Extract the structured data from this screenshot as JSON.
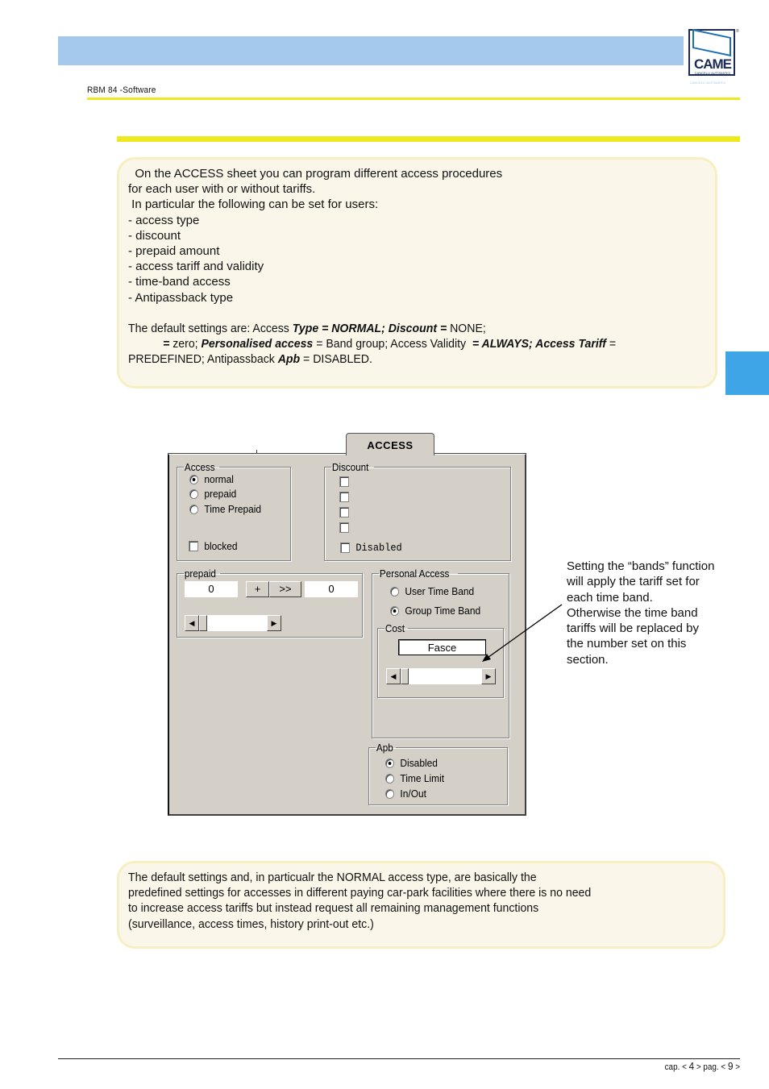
{
  "header": {
    "doc_title": "RBM 84 -Software",
    "logo": {
      "name": "CAME",
      "subtitle": "CANCELLI AUTOMATICI",
      "registered": "®"
    },
    "colors": {
      "band": "#a4c9ec",
      "rule": "#eee81e",
      "side_tab": "#3ea6e6"
    }
  },
  "intro_note": {
    "lines": [
      "  On the ACCESS sheet you can program different access procedures",
      "for each user with or without tariffs.",
      " In particular the following can be set for users:",
      "- access type",
      "- discount",
      "- prepaid amount",
      "- access tariff and validity",
      "- time-band access",
      "- Antipassback type"
    ],
    "defaults": {
      "l1_a": "The default settings are: Access ",
      "l1_b": "Type = NORMAL; Discount = ",
      "l1_c": "NONE;",
      "l2_a": "           ",
      "l2_b": "= ",
      "l2_c": "zero; ",
      "l2_d": "Personalised access",
      "l2_e": " = Band group; Access Validity  ",
      "l2_f": "= ALWAYS; Access Tariff",
      "l2_g": " =",
      "l3_a": "PREDEFINED; Antipassback ",
      "l3_b": "Apb",
      "l3_c": " = DISABLED."
    }
  },
  "dialog": {
    "active_tab": "ACCESS",
    "access_group": {
      "legend": "Access",
      "options": [
        {
          "label": "normal",
          "selected": true
        },
        {
          "label": "prepaid",
          "selected": false
        },
        {
          "label": "Time Prepaid",
          "selected": false
        }
      ],
      "blocked": {
        "label": "blocked",
        "checked": false
      }
    },
    "discount_group": {
      "legend": "Discount",
      "checkboxes": [
        false,
        false,
        false,
        false
      ],
      "disabled": {
        "label": "Disabled",
        "checked": false
      }
    },
    "prepaid_group": {
      "legend": "prepaid",
      "left_value": "0",
      "plus_label": "+",
      "transfer_label": ">>",
      "right_value": "0",
      "scroll_left": "◀",
      "scroll_right": "▶"
    },
    "personal_access_group": {
      "legend": "Personal Access",
      "options": [
        {
          "label": "User Time Band",
          "selected": false
        },
        {
          "label": "Group Time Band",
          "selected": true
        }
      ],
      "cost": {
        "legend": "Cost",
        "value": "Fasce",
        "scroll_left": "◀",
        "scroll_right": "▶"
      }
    },
    "apb_group": {
      "legend": "Apb",
      "options": [
        {
          "label": "Disabled",
          "selected": true
        },
        {
          "label": "Time Limit",
          "selected": false
        },
        {
          "label": "In/Out",
          "selected": false
        }
      ]
    }
  },
  "callout": {
    "lines": [
      "Setting the “bands” function",
      "will apply the tariff set for",
      "each time band.",
      "Otherwise the time band",
      "tariffs will be replaced by",
      "the number set on this",
      "section."
    ]
  },
  "bottom_note": {
    "lines": [
      "The default settings and, in particualr the NORMAL access type, are basically the",
      "predefined settings for accesses in different paying car-park facilities where there is no need",
      "to increase access tariffs but instead request all remaining management functions",
      "(surveillance, access times, history print-out etc.)"
    ]
  },
  "footer": {
    "cap_label": "cap. < ",
    "chapter": "4",
    "mid_label": " > pag. < ",
    "page": "9",
    "end_label": " >"
  }
}
